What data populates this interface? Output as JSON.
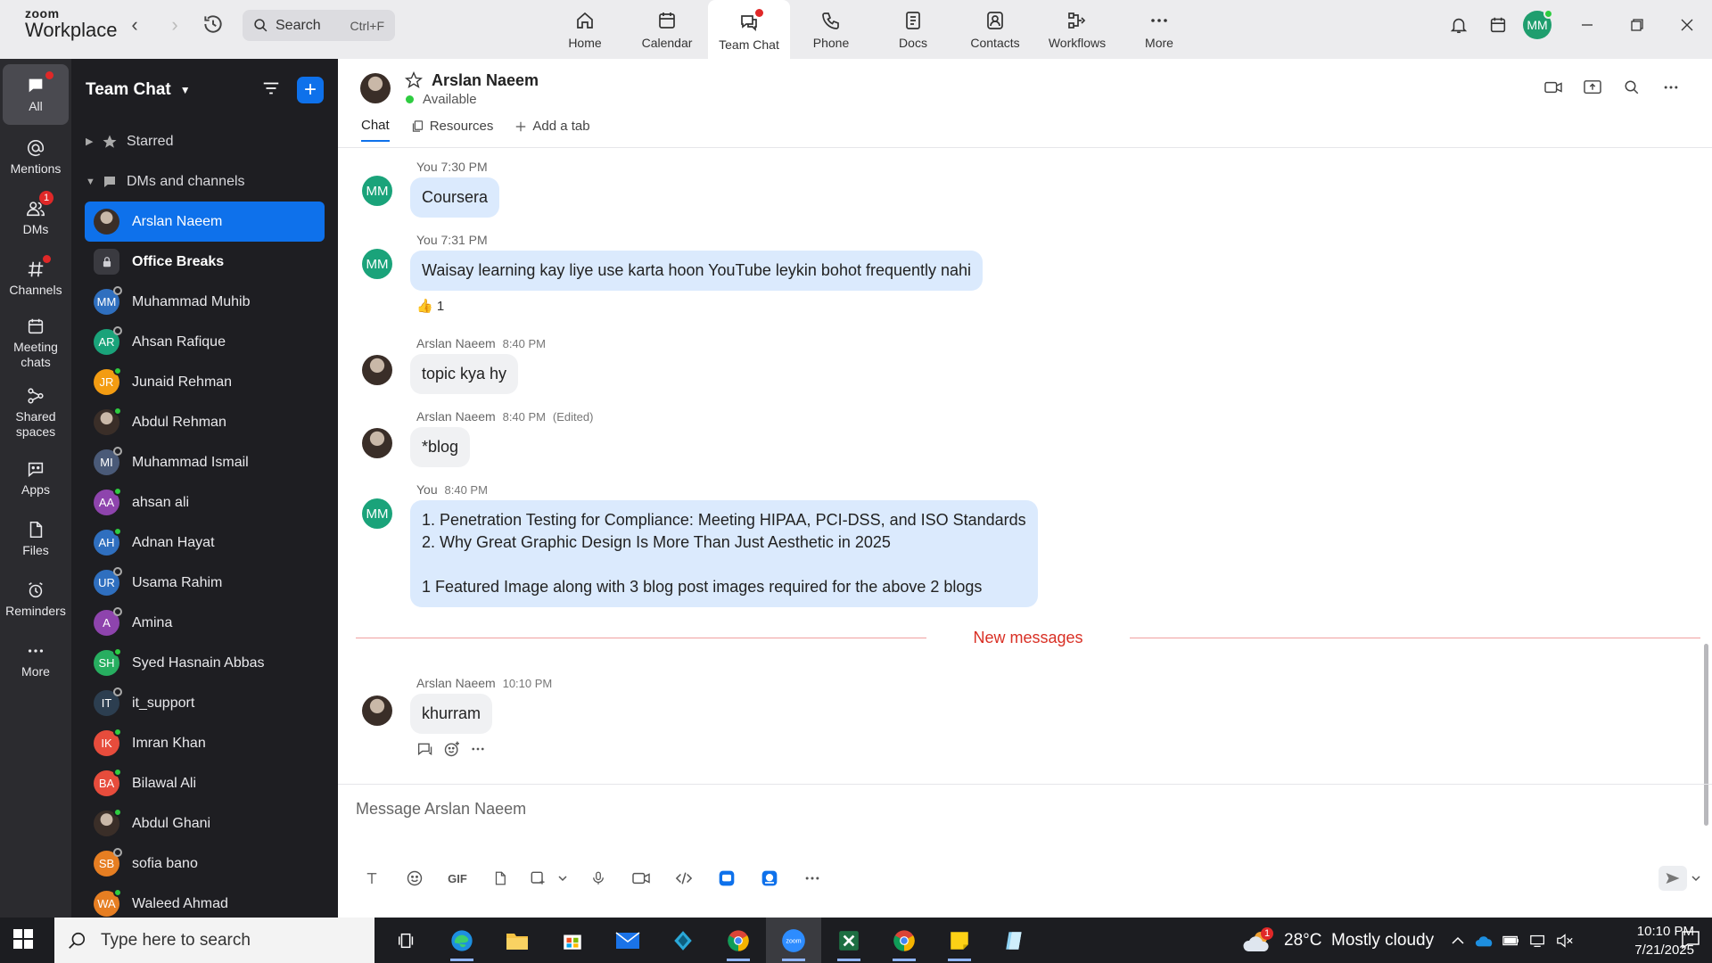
{
  "app": {
    "logo_top": "zoom",
    "logo_bottom": "Workplace",
    "search_label": "Search",
    "search_shortcut": "Ctrl+F",
    "user_initials": "MM"
  },
  "topnav": [
    {
      "label": "Home",
      "icon": "home-icon"
    },
    {
      "label": "Calendar",
      "icon": "calendar-icon"
    },
    {
      "label": "Team Chat",
      "icon": "chat-icon",
      "active": true
    },
    {
      "label": "Phone",
      "icon": "phone-icon"
    },
    {
      "label": "Docs",
      "icon": "docs-icon"
    },
    {
      "label": "Contacts",
      "icon": "contacts-icon"
    },
    {
      "label": "Workflows",
      "icon": "workflows-icon"
    },
    {
      "label": "More",
      "icon": "more-icon"
    }
  ],
  "rail": [
    {
      "label": "All",
      "icon": "chat-bubble-icon"
    },
    {
      "label": "Mentions",
      "icon": "at-icon"
    },
    {
      "label": "DMs",
      "icon": "people-icon",
      "badge": "1"
    },
    {
      "label": "Channels",
      "icon": "hash-icon"
    },
    {
      "label": "Meeting chats",
      "icon": "calendar-icon"
    },
    {
      "label": "Shared spaces",
      "icon": "shared-icon"
    },
    {
      "label": "Apps",
      "icon": "apps-icon"
    },
    {
      "label": "Files",
      "icon": "file-icon"
    },
    {
      "label": "Reminders",
      "icon": "alarm-icon"
    },
    {
      "label": "More",
      "icon": "more-icon"
    }
  ],
  "sidebar": {
    "title": "Team Chat",
    "starred_label": "Starred",
    "dms_label": "DMs and channels",
    "items": [
      {
        "name": "Arslan Naeem",
        "initials": "",
        "color": "",
        "photo": true,
        "active": true
      },
      {
        "name": "Office Breaks",
        "initials": "",
        "color": "",
        "lock": true,
        "bold": true
      },
      {
        "name": "Muhammad Muhib",
        "initials": "MM",
        "color": "#2f6fbf",
        "presence": "off"
      },
      {
        "name": "Ahsan Rafique",
        "initials": "AR",
        "color": "#1aa37a",
        "presence": "off"
      },
      {
        "name": "Junaid Rehman",
        "initials": "JR",
        "color": "#f39c12",
        "presence": "on"
      },
      {
        "name": "Abdul Rehman",
        "initials": "",
        "color": "",
        "photo": true,
        "presence": "on"
      },
      {
        "name": "Muhammad Ismail",
        "initials": "MI",
        "color": "#4a5a78",
        "presence": "off"
      },
      {
        "name": "ahsan ali",
        "initials": "AA",
        "color": "#8e44ad",
        "presence": "on"
      },
      {
        "name": "Adnan Hayat",
        "initials": "AH",
        "color": "#2f6fbf",
        "presence": "on"
      },
      {
        "name": "Usama Rahim",
        "initials": "UR",
        "color": "#2f6fbf",
        "presence": "off"
      },
      {
        "name": "Amina",
        "initials": "A",
        "color": "#8e44ad",
        "presence": "off"
      },
      {
        "name": "Syed Hasnain Abbas",
        "initials": "SH",
        "color": "#27ae60",
        "presence": "on"
      },
      {
        "name": "it_support",
        "initials": "IT",
        "color": "#2c3e50",
        "presence": "off"
      },
      {
        "name": "Imran Khan",
        "initials": "IK",
        "color": "#e74c3c",
        "presence": "on"
      },
      {
        "name": "Bilawal Ali",
        "initials": "BA",
        "color": "#e74c3c",
        "presence": "on"
      },
      {
        "name": "Abdul Ghani",
        "initials": "",
        "color": "",
        "photo": true,
        "presence": "on"
      },
      {
        "name": "sofia bano",
        "initials": "SB",
        "color": "#e67e22",
        "presence": "off"
      },
      {
        "name": "Waleed Ahmad",
        "initials": "WA",
        "color": "#e67e22",
        "presence": "on"
      }
    ]
  },
  "chat_header": {
    "name": "Arslan Naeem",
    "status": "Available",
    "tabs": [
      "Chat",
      "Resources",
      "Add a tab"
    ]
  },
  "messages": [
    {
      "sender": "You",
      "time": "7:30 PM",
      "text": "Coursera",
      "me": true
    },
    {
      "sender": "You",
      "time": "7:31 PM",
      "text": "Waisay learning kay liye use karta hoon YouTube leykin bohot frequently nahi",
      "me": true,
      "reaction": "👍",
      "reaction_count": "1"
    },
    {
      "sender": "Arslan Naeem",
      "time": "8:40 PM",
      "text": "topic kya hy",
      "me": false
    },
    {
      "sender": "Arslan Naeem",
      "time": "8:40 PM",
      "edited": "(Edited)",
      "text": "*blog",
      "me": false
    },
    {
      "sender": "You",
      "time": "8:40 PM",
      "text": "1. Penetration Testing for Compliance: Meeting HIPAA, PCI-DSS, and ISO Standards\n2. Why Great Graphic Design Is More Than Just Aesthetic in 2025\n\n1 Featured Image along with 3 blog post images required for the above 2 blogs",
      "me": true
    },
    {
      "sender": "Arslan Naeem",
      "time": "10:10 PM",
      "text": "khurram",
      "me": false
    }
  ],
  "new_messages_label": "New messages",
  "composer": {
    "placeholder": "Message Arslan Naeem",
    "gif_label": "GIF"
  },
  "taskbar": {
    "search_placeholder": "Type here to search",
    "weather": "28°C  Mostly cloudy",
    "weather_badge": "1",
    "time": "10:10 PM",
    "date": "7/21/2025"
  }
}
